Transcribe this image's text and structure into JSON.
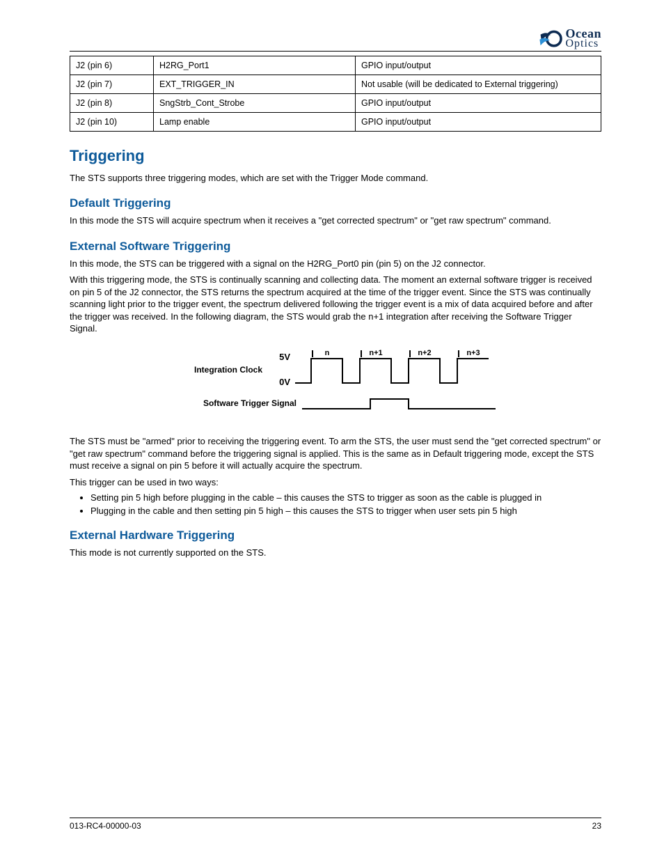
{
  "header": {
    "logo_line1": "Ocean",
    "logo_line2": "Optics"
  },
  "table": {
    "rows": [
      {
        "col0": "J2 (pin 6)",
        "col1": "H2RG_Port1",
        "col2": "GPIO input/output"
      },
      {
        "col0": "J2 (pin 7)",
        "col1": "EXT_TRIGGER_IN",
        "col2": "Not usable (will be dedicated to External triggering)"
      },
      {
        "col0": "J2 (pin 8)",
        "col1": "SngStrb_Cont_Strobe",
        "col2": "GPIO input/output"
      },
      {
        "col0": "J2 (pin 10)",
        "col1": "Lamp enable",
        "col2": "GPIO input/output"
      }
    ]
  },
  "section_trigger": {
    "heading": "Triggering",
    "p1": "The STS supports three triggering modes, which are set with the Trigger Mode command.",
    "default_heading": "Default Triggering",
    "default_p": "In this mode the STS will acquire spectrum when it receives a \"get corrected spectrum\" or \"get raw spectrum\" command.",
    "ext_heading": "External Software Triggering",
    "ext_p1": "In this mode, the STS can be triggered with a signal on the H2RG_Port0 pin (pin 5) on the J2 connector.",
    "ext_p2": "With this triggering mode, the STS is continually scanning and collecting data. The moment an external software trigger is received on pin 5 of the J2 connector, the STS returns the spectrum acquired at the time of the trigger event. Since the STS was continually scanning light prior to the trigger event, the spectrum delivered following the trigger event is a mix of data acquired before and after the trigger was received. In the following diagram, the STS would grab the n+1 integration after receiving the Software Trigger Signal.",
    "ext_p3": "The STS must be \"armed\" prior to receiving the triggering event. To arm the STS, the user must send the \"get corrected spectrum\" or \"get raw spectrum\" command before the triggering signal is applied. This is the same as in Default triggering mode, except the STS must receive a signal on pin 5 before it will actually acquire the spectrum.",
    "ext_p4": "This trigger can be used in two ways:",
    "bullets": [
      "Setting pin 5 high before plugging in the cable – this causes the STS to trigger as soon as the cable is plugged in",
      "Plugging in the cable and then setting pin 5 high – this causes the STS to trigger when user sets pin 5 high"
    ],
    "hw_heading": "External Hardware Triggering",
    "hw_p": "This mode is not currently supported on the STS."
  },
  "diagram": {
    "label_clock": "Integration Clock",
    "label_trigger": "Software Trigger Signal",
    "v_high": "5V",
    "v_low": "0V",
    "markers": [
      "n",
      "n+1",
      "n+2",
      "n+3"
    ]
  },
  "footer": {
    "left": "013-RC4-00000-03",
    "right": "23"
  }
}
